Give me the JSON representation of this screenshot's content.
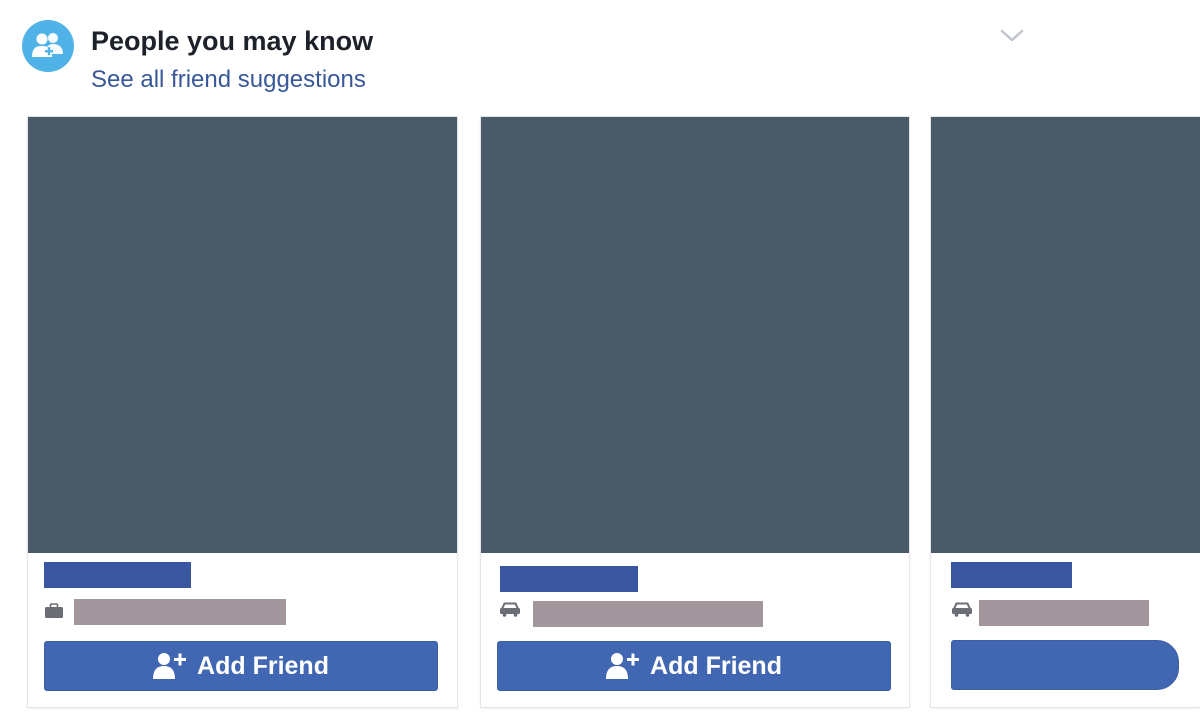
{
  "header": {
    "title": "People you may know",
    "see_all_link": "See all friend suggestions",
    "icon": "people-icon",
    "accent_color": "#4fb3e8",
    "link_color": "#385898"
  },
  "cards": [
    {
      "info_icon": "briefcase-icon",
      "button_label": "Add Friend",
      "button_icon": "add-friend-icon"
    },
    {
      "info_icon": "car-icon",
      "button_label": "Add Friend",
      "button_icon": "add-friend-icon"
    },
    {
      "info_icon": "car-icon",
      "button_label": "",
      "button_icon": ""
    }
  ],
  "colors": {
    "button": "#4267b2",
    "photo_placeholder": "#4a5a68",
    "name_redaction": "#3a56a0",
    "info_redaction": "#a3969c"
  }
}
